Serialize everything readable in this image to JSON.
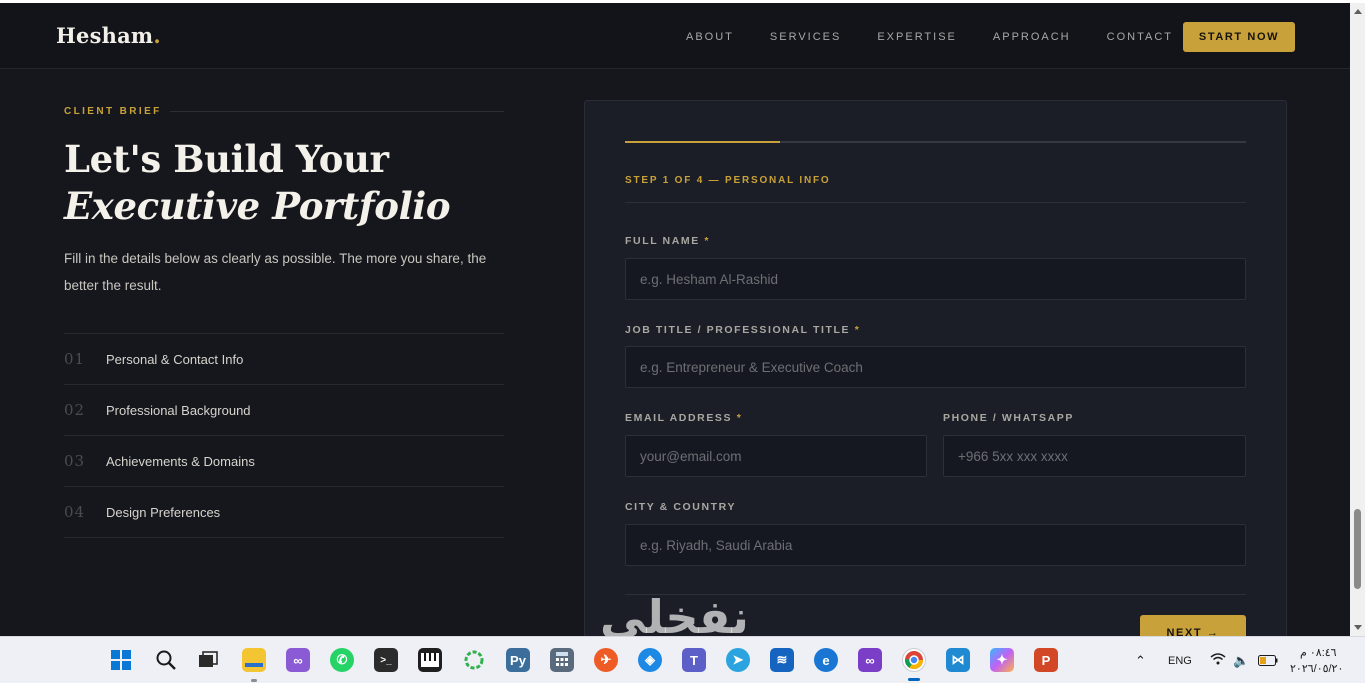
{
  "nav": {
    "brand": "Hesham",
    "brand_dot": ".",
    "links": [
      "ABOUT",
      "SERVICES",
      "EXPERTISE",
      "APPROACH",
      "CONTACT"
    ],
    "cta": "START NOW"
  },
  "hero": {
    "label": "CLIENT BRIEF",
    "title_line1": "Let's Build Your",
    "title_line2": "Executive Portfolio",
    "intro": "Fill in the details below as clearly as possible. The more you share, the better the result."
  },
  "steps": [
    {
      "num": "01",
      "label": "Personal & Contact Info"
    },
    {
      "num": "02",
      "label": "Professional Background"
    },
    {
      "num": "03",
      "label": "Achievements & Domains"
    },
    {
      "num": "04",
      "label": "Design Preferences"
    }
  ],
  "form": {
    "progress_fraction": 0.25,
    "step_caption": "STEP 1 OF 4 — PERSONAL INFO",
    "full_name": {
      "label": "FULL NAME",
      "required": "*",
      "placeholder": "e.g. Hesham Al-Rashid",
      "value": ""
    },
    "job_title": {
      "label": "JOB TITLE / PROFESSIONAL TITLE",
      "required": "*",
      "placeholder": "e.g. Entrepreneur & Executive Coach",
      "value": ""
    },
    "email": {
      "label": "EMAIL ADDRESS",
      "required": "*",
      "placeholder": "your@email.com",
      "value": ""
    },
    "phone": {
      "label": "PHONE / WHATSAPP",
      "placeholder": "+966 5xx xxx xxxx",
      "value": ""
    },
    "city": {
      "label": "CITY & COUNTRY",
      "placeholder": "e.g. Riyadh, Saudi Arabia",
      "value": ""
    },
    "next": "NEXT →"
  },
  "watermark": "نفخلي",
  "colors": {
    "accent": "#c9a13b",
    "background": "#15171d",
    "card": "#1b1e26",
    "nav": "#121419"
  },
  "taskbar": {
    "icons": [
      "windows-start-icon",
      "search-icon",
      "task-view-icon",
      "file-explorer-icon",
      "visual-studio-icon",
      "whatsapp-icon",
      "terminal-icon",
      "piano-app-icon",
      "circle-app-icon",
      "python-ide-icon",
      "calculator-icon",
      "postman-icon",
      "flutter-icon",
      "teams-icon",
      "telegram-icon",
      "database-icon",
      "edge-icon",
      "visual-studio-purple-icon",
      "chrome-icon",
      "vscode-icon",
      "copilot-icon",
      "powerpoint-icon"
    ],
    "language": "ENG",
    "time": "٠٨:٤٦ م",
    "date": "٢٠٢٦/٠٥/٢٠"
  }
}
